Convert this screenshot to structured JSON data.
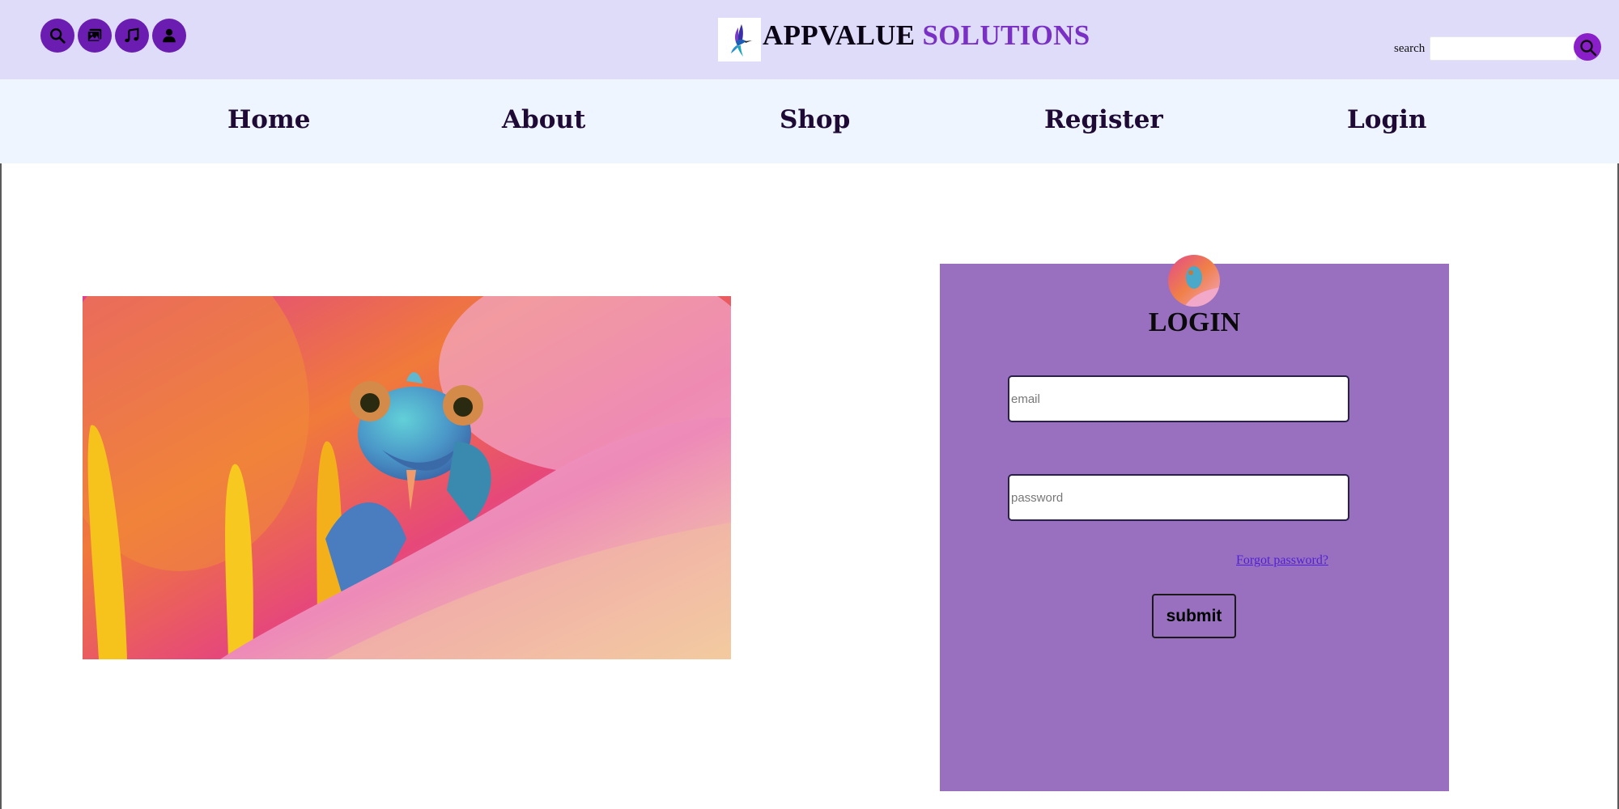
{
  "header": {
    "icons": [
      "search-icon",
      "image-icon",
      "music-icon",
      "user-icon"
    ],
    "brand_name_part1": "APPVALUE",
    "brand_name_part2": "SOLUTIONS",
    "search_label": "search",
    "search_value": ""
  },
  "nav": {
    "items": [
      "Home",
      "About",
      "Shop",
      "Register",
      "Login"
    ]
  },
  "login": {
    "title": "LOGIN",
    "email_placeholder": "email",
    "password_placeholder": "password",
    "forgot_link": "Forgot password?",
    "submit_label": "submit"
  },
  "colors": {
    "header_bg": "#dedcf9",
    "nav_bg": "#eef5ff",
    "accent_purple": "#6a1db0",
    "brand_purple": "#7a30c4",
    "panel_bg": "#9870bf",
    "link": "#4f1fd6"
  }
}
